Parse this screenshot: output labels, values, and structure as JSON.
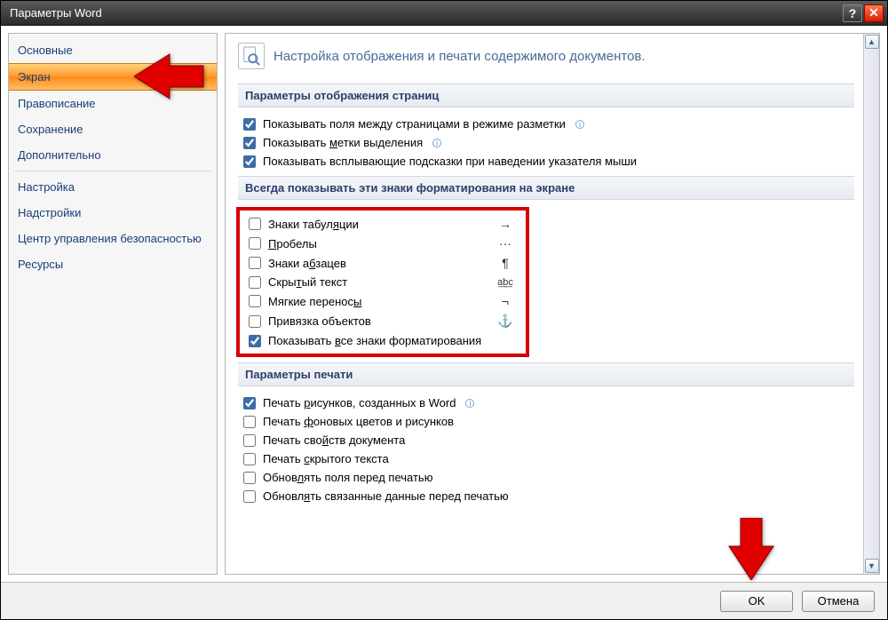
{
  "window": {
    "title": "Параметры Word"
  },
  "sidebar": {
    "items": [
      {
        "label": "Основные"
      },
      {
        "label": "Экран",
        "selected": true
      },
      {
        "label": "Правописание"
      },
      {
        "label": "Сохранение"
      },
      {
        "label": "Дополнительно"
      },
      {
        "sep": true
      },
      {
        "label": "Настройка"
      },
      {
        "label": "Надстройки"
      },
      {
        "label": "Центр управления безопасностью"
      },
      {
        "label": "Ресурсы"
      }
    ]
  },
  "main": {
    "heading": "Настройка отображения и печати содержимого документов.",
    "section1": {
      "title": "Параметры отображения страниц",
      "opts": [
        {
          "label": "Показывать поля между страницами в режиме разметки",
          "checked": true,
          "info": true
        },
        {
          "label_pre": "Показывать ",
          "u": "м",
          "label_post": "етки выделения",
          "checked": true,
          "info": true
        },
        {
          "label": "Показывать всплывающие подсказки при наведении указателя мыши",
          "checked": true
        }
      ]
    },
    "section2": {
      "title": "Всегда показывать эти знаки форматирования на экране",
      "opts": [
        {
          "label_pre": "Знаки табул",
          "u": "я",
          "label_post": "ции",
          "sym": "→"
        },
        {
          "label_pre": "",
          "u": "П",
          "label_post": "робелы",
          "sym": "···"
        },
        {
          "label_pre": "Знаки а",
          "u": "б",
          "label_post": "зацев",
          "sym": "¶"
        },
        {
          "label_pre": "Скры",
          "u": "т",
          "label_post": "ый текст",
          "sym": "a͟b͟c"
        },
        {
          "label_pre": "Мягкие перенос",
          "u": "ы",
          "label_post": "",
          "sym": "¬"
        },
        {
          "label": "Привязка объектов",
          "sym": "⚓"
        },
        {
          "label_pre": "Показывать ",
          "u": "в",
          "label_post": "се знаки форматирования",
          "checked": true
        }
      ]
    },
    "section3": {
      "title": "Параметры печати",
      "opts": [
        {
          "label_pre": "Печать ",
          "u": "р",
          "label_post": "исунков, созданных в Word",
          "checked": true,
          "info": true
        },
        {
          "label_pre": "Печать ",
          "u": "ф",
          "label_post": "оновых цветов и рисунков"
        },
        {
          "label_pre": "Печать сво",
          "u": "й",
          "label_post": "ств документа"
        },
        {
          "label_pre": "Печать ",
          "u": "с",
          "label_post": "крытого текста"
        },
        {
          "label_pre": "Обнов",
          "u": "л",
          "label_post": "ять поля перед печатью"
        },
        {
          "label_pre": "Обновл",
          "u": "я",
          "label_post": "ть связанные данные перед печатью"
        }
      ]
    }
  },
  "buttons": {
    "ok": "OK",
    "cancel": "Отмена"
  }
}
